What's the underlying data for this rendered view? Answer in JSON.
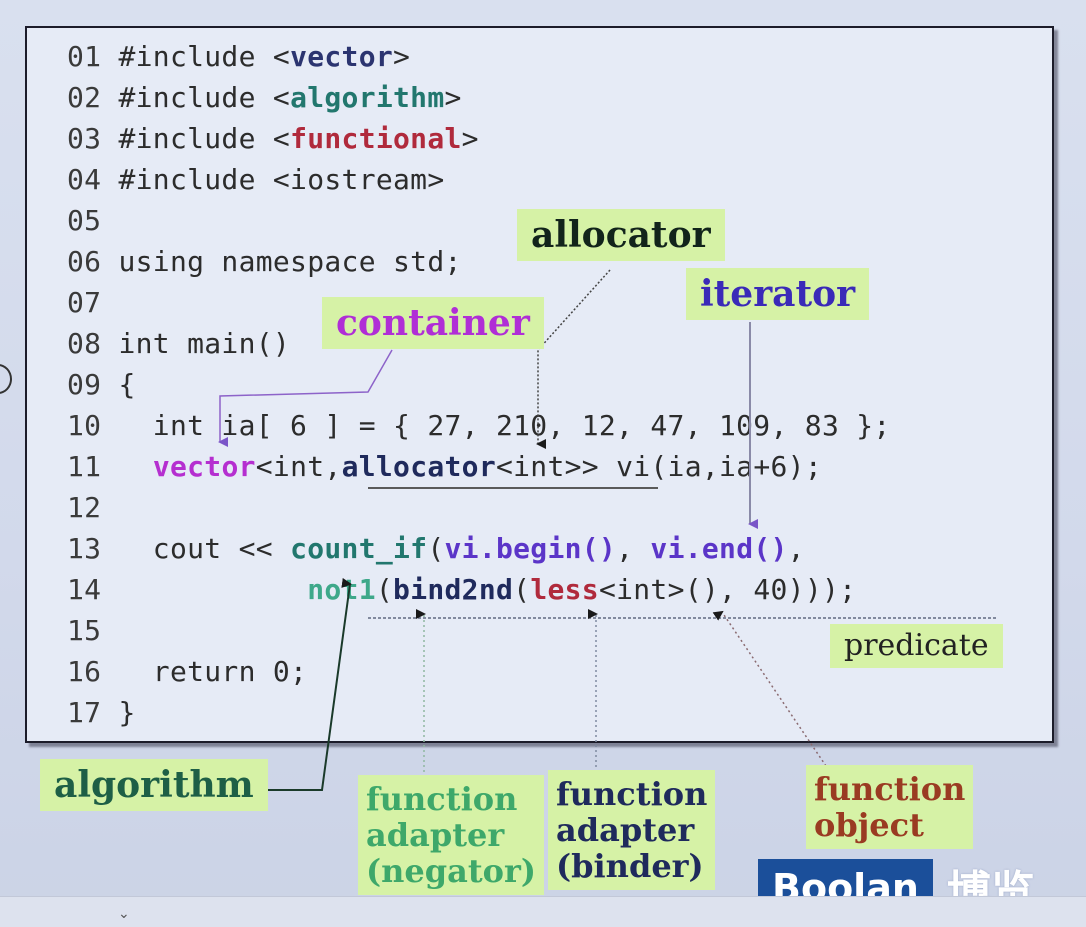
{
  "code": [
    {
      "no": "01",
      "parts": [
        {
          "t": "#include <"
        },
        {
          "t": "vector",
          "c": "kw-blue"
        },
        {
          "t": ">"
        }
      ]
    },
    {
      "no": "02",
      "parts": [
        {
          "t": "#include <"
        },
        {
          "t": "algorithm",
          "c": "kw-teal"
        },
        {
          "t": ">"
        }
      ]
    },
    {
      "no": "03",
      "parts": [
        {
          "t": "#include <"
        },
        {
          "t": "functional",
          "c": "kw-red"
        },
        {
          "t": ">"
        }
      ]
    },
    {
      "no": "04",
      "parts": [
        {
          "t": "#include <iostream>"
        }
      ]
    },
    {
      "no": "05",
      "parts": [
        {
          "t": ""
        }
      ]
    },
    {
      "no": "06",
      "parts": [
        {
          "t": "using namespace std;"
        }
      ]
    },
    {
      "no": "07",
      "parts": [
        {
          "t": ""
        }
      ]
    },
    {
      "no": "08",
      "parts": [
        {
          "t": "int main()"
        }
      ]
    },
    {
      "no": "09",
      "parts": [
        {
          "t": "{"
        }
      ]
    },
    {
      "no": "10",
      "parts": [
        {
          "t": "  int ia[ 6 ] = { 27, 210, 12, 47, 109, 83 };"
        }
      ]
    },
    {
      "no": "11",
      "parts": [
        {
          "t": "  "
        },
        {
          "t": "vector",
          "c": "kw-purple"
        },
        {
          "t": "<int,"
        },
        {
          "t": "allocator",
          "c": "kw-navy"
        },
        {
          "t": "<int>> vi(ia,ia+6);"
        }
      ]
    },
    {
      "no": "12",
      "parts": [
        {
          "t": ""
        }
      ]
    },
    {
      "no": "13",
      "parts": [
        {
          "t": "  cout << "
        },
        {
          "t": "count_if",
          "c": "kw-teal"
        },
        {
          "t": "("
        },
        {
          "t": "vi.begin()",
          "c": "kw-vi"
        },
        {
          "t": ", "
        },
        {
          "t": "vi.end()",
          "c": "kw-vi"
        },
        {
          "t": ","
        }
      ]
    },
    {
      "no": "14",
      "parts": [
        {
          "t": "           "
        },
        {
          "t": "not1",
          "c": "kw-teal2"
        },
        {
          "t": "("
        },
        {
          "t": "bind2nd",
          "c": "kw-navy"
        },
        {
          "t": "("
        },
        {
          "t": "less",
          "c": "kw-red"
        },
        {
          "t": "<int>(), 40)));"
        }
      ]
    },
    {
      "no": "15",
      "parts": [
        {
          "t": ""
        }
      ]
    },
    {
      "no": "16",
      "parts": [
        {
          "t": "  return 0;"
        }
      ]
    },
    {
      "no": "17",
      "parts": [
        {
          "t": "}"
        }
      ]
    }
  ],
  "labels": {
    "allocator": "allocator",
    "iterator": "iterator",
    "container": "container",
    "predicate": "predicate",
    "algorithm": "algorithm",
    "function_adapter_negator": "function\nadapter\n(negator)",
    "function_adapter_binder": "function\nadapter\n(binder)",
    "function_object": "function\nobject"
  },
  "brand": {
    "name": "Boolan",
    "cn": "博览"
  },
  "colors": {
    "label_bg": "#d6f2a6",
    "code_bg": "#e6ebf6",
    "brand_blue": "#1b4f9a"
  }
}
